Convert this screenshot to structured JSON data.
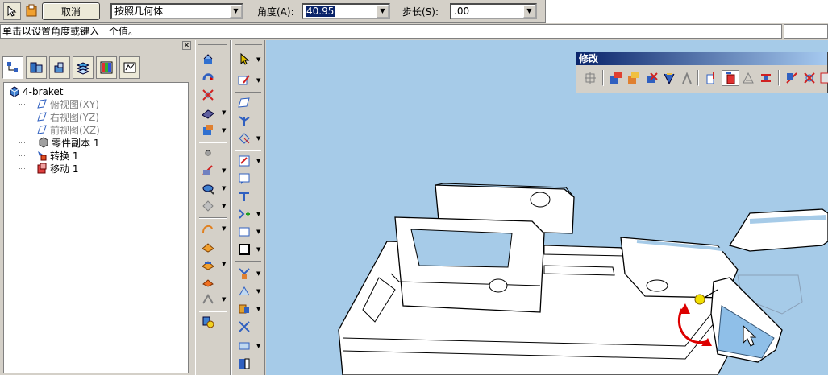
{
  "command_bar": {
    "cancel_label": "取消",
    "method_value": "按照几何体",
    "angle_label": "角度(A):",
    "angle_value": "40.95",
    "step_label": "步长(S):",
    "step_value": ".00"
  },
  "prompt": {
    "text": "单击以设置角度或键入一个值。"
  },
  "panel": {
    "close_label": "×",
    "tree": {
      "root": "4-braket",
      "items": [
        {
          "label": "俯视图(XY)",
          "state": "hidden"
        },
        {
          "label": "右视图(YZ)",
          "state": "hidden"
        },
        {
          "label": "前视图(XZ)",
          "state": "hidden"
        },
        {
          "label": "零件副本 1",
          "state": "normal"
        },
        {
          "label": "转换 1",
          "state": "normal"
        },
        {
          "label": "移动 1",
          "state": "normal"
        }
      ]
    }
  },
  "modify_toolbar": {
    "title": "修改"
  },
  "colors": {
    "viewport_bg": "#a6cbe8",
    "selection": "#0a246a",
    "rotate_handle": "#dd0000",
    "handle_dot": "#f2e000"
  }
}
